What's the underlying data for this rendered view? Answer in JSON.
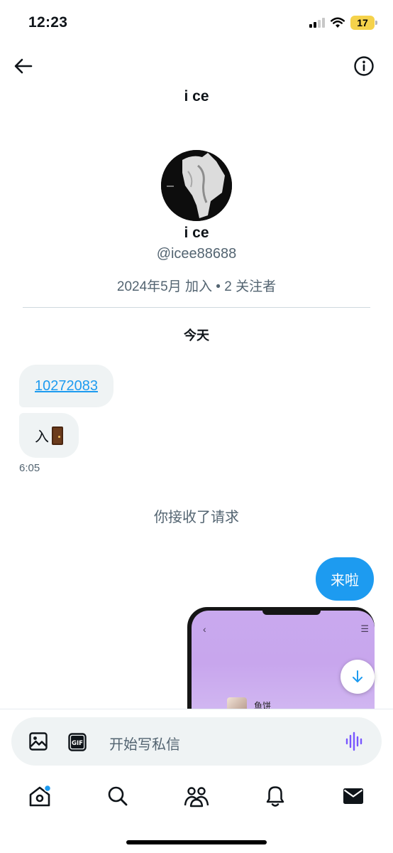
{
  "status_bar": {
    "time": "12:23",
    "battery": "17"
  },
  "header": {
    "title": "i ce"
  },
  "profile": {
    "name": "i ce",
    "handle": "@icee88688",
    "meta": "2024年5月 加入 • 2 关注者"
  },
  "conversation": {
    "day_label": "今天",
    "messages": [
      {
        "direction": "incoming",
        "text": "10272083",
        "is_link": true
      },
      {
        "direction": "incoming",
        "text": "入",
        "emoji": "door"
      }
    ],
    "incoming_time": "6:05",
    "system_note": "你接收了请求",
    "outgoing_message": "来啦",
    "attachment": {
      "contact_name": "鱼饼"
    }
  },
  "composer": {
    "placeholder": "开始写私信"
  },
  "tabs": [
    "home",
    "search",
    "communities",
    "notifications",
    "messages"
  ],
  "colors": {
    "accent": "#1d9bf0",
    "bubble_incoming": "#eff3f4",
    "voice_icon": "#7856ff"
  }
}
